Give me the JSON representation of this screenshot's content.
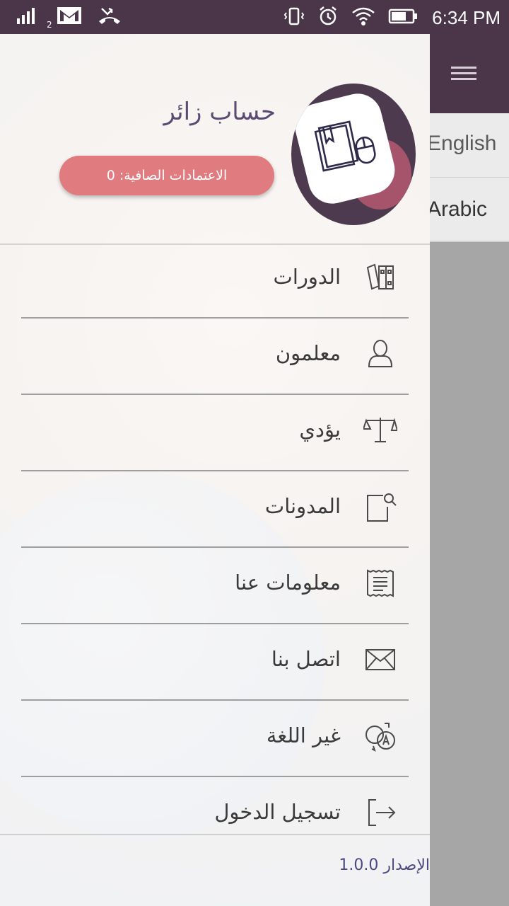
{
  "status_bar": {
    "time": "6:34 PM",
    "sim_label": "2"
  },
  "background_screen": {
    "language_items": [
      "English",
      "Arabic"
    ]
  },
  "drawer": {
    "user_name": "حساب زائر",
    "credits_label": "الاعتمادات الصافية: 0",
    "menu": [
      {
        "label": "الدورات",
        "icon": "books-icon"
      },
      {
        "label": "معلمون",
        "icon": "user-icon"
      },
      {
        "label": "يؤدي",
        "icon": "scale-icon"
      },
      {
        "label": "المدونات",
        "icon": "blog-icon"
      },
      {
        "label": "معلومات عنا",
        "icon": "receipt-icon"
      },
      {
        "label": "اتصل بنا",
        "icon": "mail-icon"
      },
      {
        "label": "غير اللغة",
        "icon": "translate-icon"
      },
      {
        "label": "تسجيل الدخول",
        "icon": "login-icon"
      }
    ],
    "version": "الإصدار 1.0.0"
  },
  "colors": {
    "primary": "#4a3549",
    "accent_button": "#e07b80",
    "logo_accent": "#a5546c",
    "menu_text": "#3a3a3a"
  }
}
